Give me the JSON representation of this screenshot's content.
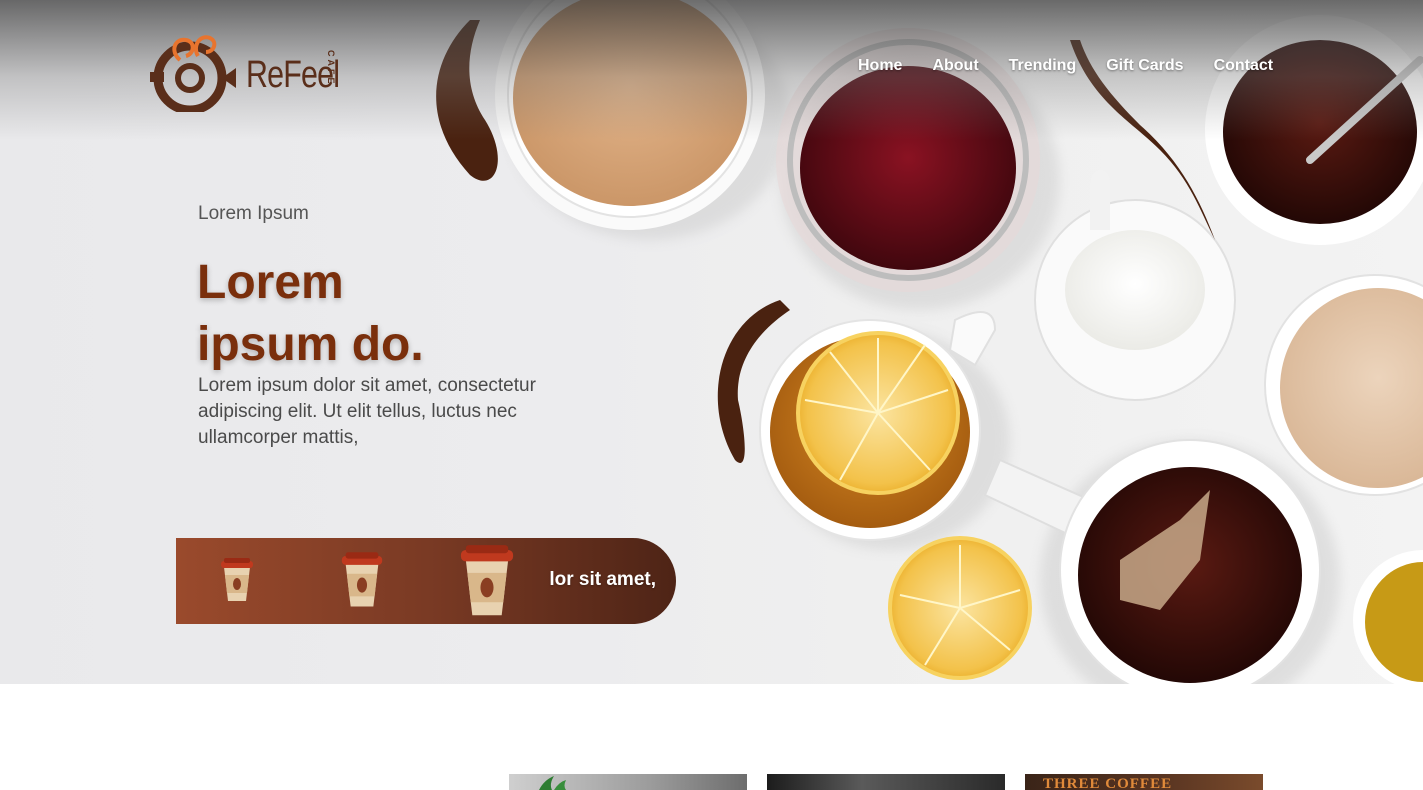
{
  "brand": {
    "name": "ReFeel",
    "sub": "CAFE"
  },
  "nav": {
    "items": [
      "Home",
      "About",
      "Trending",
      "Gift Cards",
      "Contact"
    ]
  },
  "hero": {
    "eyebrow": "Lorem Ipsum",
    "headline_line1": "Lorem",
    "headline_line2": "ipsum do.",
    "description": "Lorem ipsum dolor sit amet, consectetur adipiscing elit. Ut elit tellus, luctus nec ullamcorper mattis,"
  },
  "promo": {
    "text": "lor sit amet,",
    "icons": [
      "coffee-cup-icon",
      "coffee-cup-icon",
      "coffee-cup-icon"
    ]
  },
  "gallery": {
    "thumb3_text": "THREE COFFEE"
  },
  "colors": {
    "accent": "#7a2f0c",
    "brand_brown": "#5a2e1a",
    "promo_start": "#9a4a2c",
    "promo_end": "#4e2416",
    "logo_orange": "#e8742e"
  }
}
